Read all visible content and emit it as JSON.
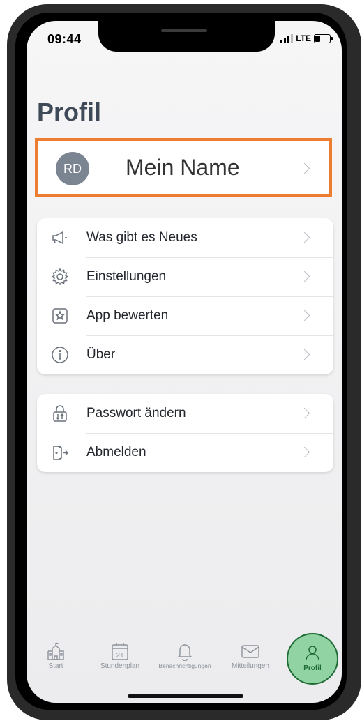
{
  "status_bar": {
    "time": "09:44",
    "network": "LTE"
  },
  "page_title": "Profil",
  "profile": {
    "initials": "RD",
    "name": "Mein Name"
  },
  "menu_group_1": [
    {
      "label": "Was gibt es Neues",
      "icon": "megaphone-icon"
    },
    {
      "label": "Einstellungen",
      "icon": "gear-icon"
    },
    {
      "label": "App bewerten",
      "icon": "star-icon"
    },
    {
      "label": "Über",
      "icon": "info-icon"
    }
  ],
  "menu_group_2": [
    {
      "label": "Passwort ändern",
      "icon": "lock-icon"
    },
    {
      "label": "Abmelden",
      "icon": "logout-icon"
    }
  ],
  "tabbar": {
    "tabs": [
      {
        "label": "Start",
        "icon": "school-icon"
      },
      {
        "label": "Stundenplan",
        "icon": "calendar-icon",
        "calendar_day": "21"
      },
      {
        "label": "Benachrichtigungen",
        "icon": "bell-icon"
      },
      {
        "label": "Mitteilungen",
        "icon": "mail-icon"
      },
      {
        "label": "Profil",
        "icon": "person-icon",
        "active": true
      }
    ]
  },
  "colors": {
    "highlight": "#ed7d31",
    "active_tab_bg": "#92d3a4",
    "active_tab_fg": "#1e6b35",
    "avatar": "#7b8591"
  }
}
